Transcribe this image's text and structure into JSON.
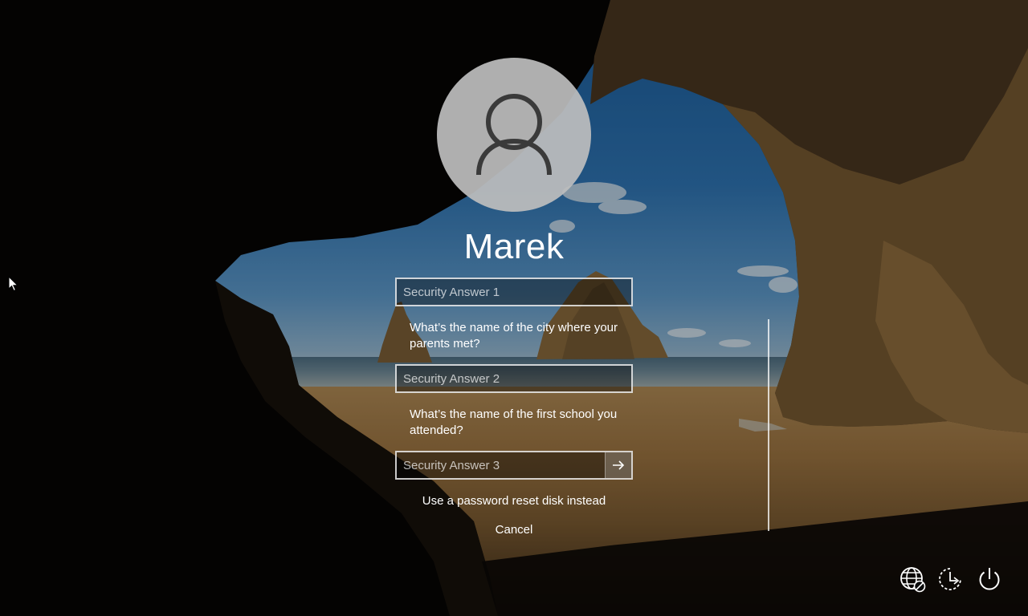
{
  "user": {
    "name": "Marek"
  },
  "fields": {
    "answer1_placeholder": "Security Answer 1",
    "answer1_value": "",
    "answer2_placeholder": "Security Answer 2",
    "answer2_value": "",
    "answer3_placeholder": "Security Answer 3",
    "answer3_value": ""
  },
  "questions": {
    "q1": "What’s the name of the city where your parents met?",
    "q2": "What’s the name of the first school you attended?"
  },
  "links": {
    "reset_disk": "Use a password reset disk instead",
    "cancel": "Cancel"
  },
  "icons": {
    "avatar": "user-silhouette-icon",
    "submit": "arrow-right-icon",
    "network": "network-globe-icon",
    "ease_of_access": "ease-of-access-icon",
    "power": "power-icon",
    "cursor": "mouse-pointer-icon"
  },
  "colors": {
    "text": "#ffffff",
    "field_border": "#c7c7c7",
    "avatar_bg": "#bebebe",
    "avatar_glyph": "#3a3a3a"
  }
}
